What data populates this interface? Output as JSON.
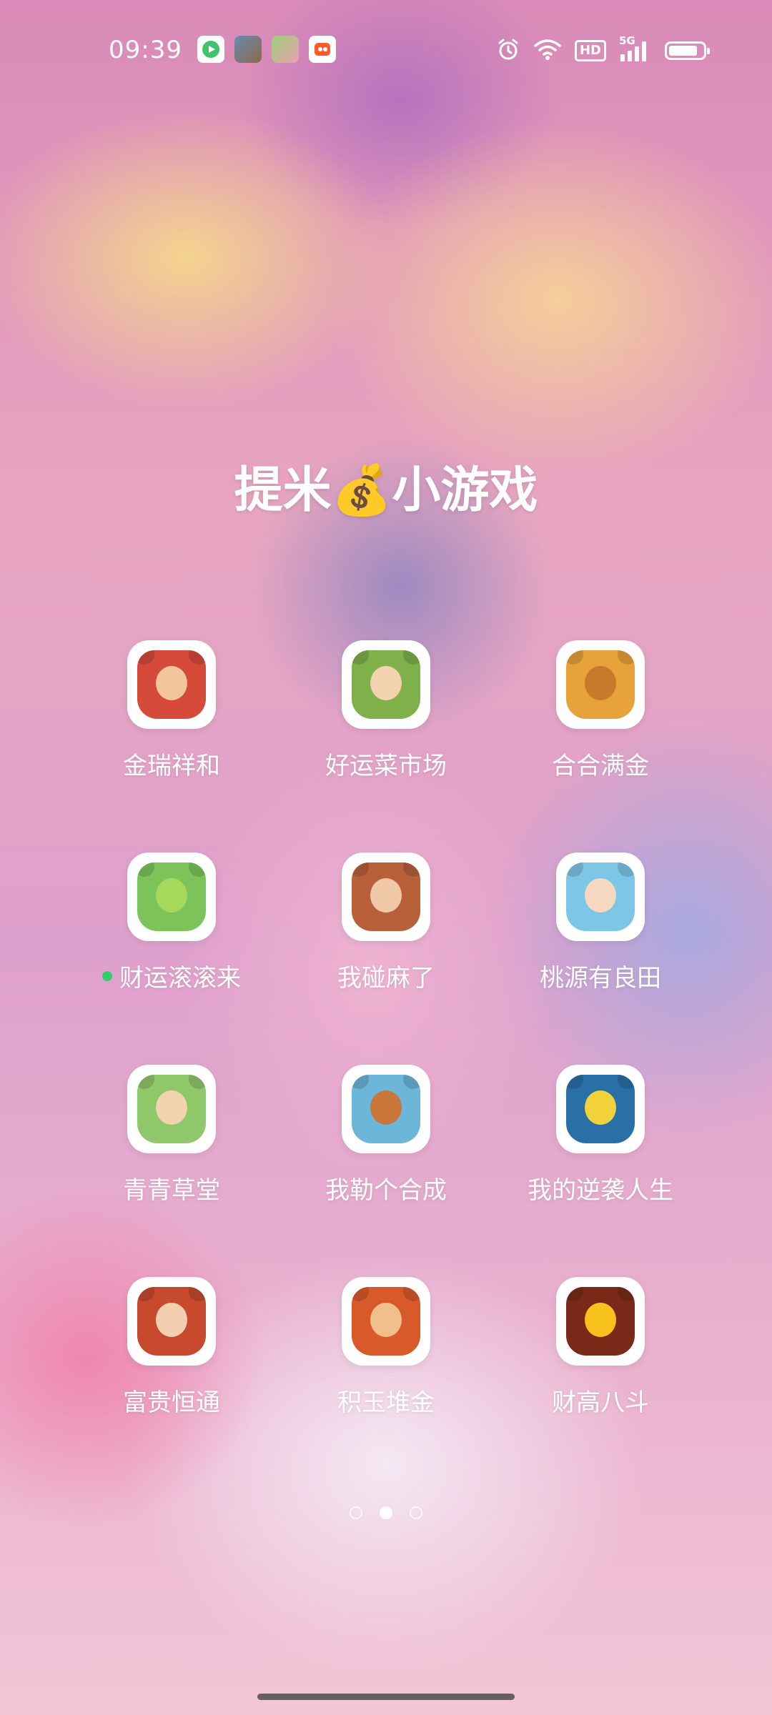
{
  "status_bar": {
    "time": "09:39",
    "notifications": [
      {
        "icon": "video-app-notification-icon",
        "color": "#3ec46d"
      },
      {
        "icon": "game-app-notification-icon",
        "color": "#8a6a4a"
      },
      {
        "icon": "pig-game-notification-icon",
        "color": "#e9a0b0"
      },
      {
        "icon": "video-player-notification-icon",
        "color": "#ffd23a"
      }
    ],
    "hd_label": "HD",
    "network_label": "5G",
    "battery_level": 0.85
  },
  "folder": {
    "title_prefix": "提米",
    "title_emoji": "💰",
    "title_suffix": "小游戏"
  },
  "apps": [
    {
      "label": "金瑞祥和",
      "icon": "fortune-god-icon",
      "bg": "#d64a3a",
      "face": "#f2c59a",
      "new": false
    },
    {
      "label": "好运菜市场",
      "icon": "farmer-girl-icon",
      "bg": "#7fb04a",
      "face": "#f3d2b0",
      "new": false
    },
    {
      "label": "合合满金",
      "icon": "treasure-chest-icon",
      "bg": "#e8a23a",
      "face": "#c67a2a",
      "new": false
    },
    {
      "label": "财运滚滚来",
      "icon": "crocodile-icon",
      "bg": "#7cc35a",
      "face": "#a6d85a",
      "new": true
    },
    {
      "label": "我碰麻了",
      "icon": "lady-portrait-icon",
      "bg": "#b8603a",
      "face": "#f0c9a8",
      "new": false
    },
    {
      "label": "桃源有良田",
      "icon": "girl-portrait-icon",
      "bg": "#7ec6e6",
      "face": "#f6d8c0",
      "new": false
    },
    {
      "label": "青青草堂",
      "icon": "herbalist-girl-icon",
      "bg": "#8fc86a",
      "face": "#f3d2b0",
      "new": false
    },
    {
      "label": "我勒个合成",
      "icon": "vegetable-merge-icon",
      "bg": "#6bb6d9",
      "face": "#c8763a",
      "new": false
    },
    {
      "label": "我的逆袭人生",
      "icon": "sports-car-icon",
      "bg": "#2a6fa6",
      "face": "#f2d23a",
      "new": false
    },
    {
      "label": "富贵恒通",
      "icon": "lady-red-dress-icon",
      "bg": "#c84a2e",
      "face": "#f3cfb0",
      "new": false
    },
    {
      "label": "积玉堆金",
      "icon": "merchant-icon",
      "bg": "#d85a2a",
      "face": "#f0bf8a",
      "new": false
    },
    {
      "label": "财高八斗",
      "icon": "gold-characters-icon",
      "bg": "#7a2a18",
      "face": "#f7c21e",
      "new": false
    }
  ],
  "pager": {
    "pages": 3,
    "active": 1
  }
}
